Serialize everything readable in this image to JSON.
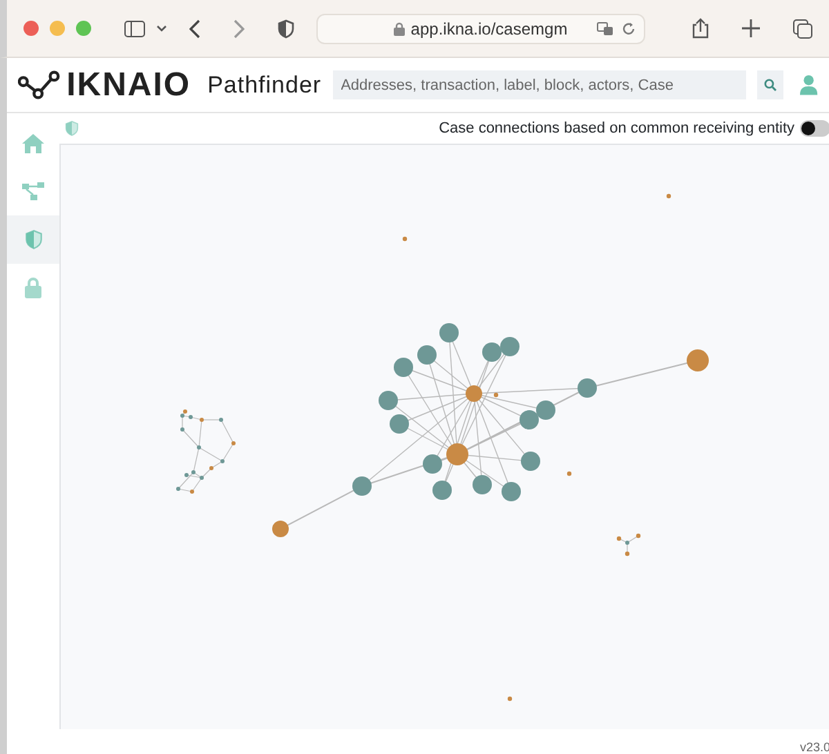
{
  "browser": {
    "url": "app.ikna.io/casemgm"
  },
  "header": {
    "logo": "IKNAIO",
    "product": "Pathfinder",
    "search": {
      "placeholder": "Addresses, transaction, label, block, actors, Case"
    }
  },
  "sidebar": {
    "items": [
      {
        "kind": "home",
        "selected": false
      },
      {
        "kind": "graph",
        "selected": false
      },
      {
        "kind": "shield",
        "selected": true
      },
      {
        "kind": "lock",
        "selected": false
      }
    ]
  },
  "toolbar": {
    "toggle": {
      "label": "Case connections based on common receiving entity",
      "on": false
    }
  },
  "footer": {
    "version": "v23.0"
  }
}
